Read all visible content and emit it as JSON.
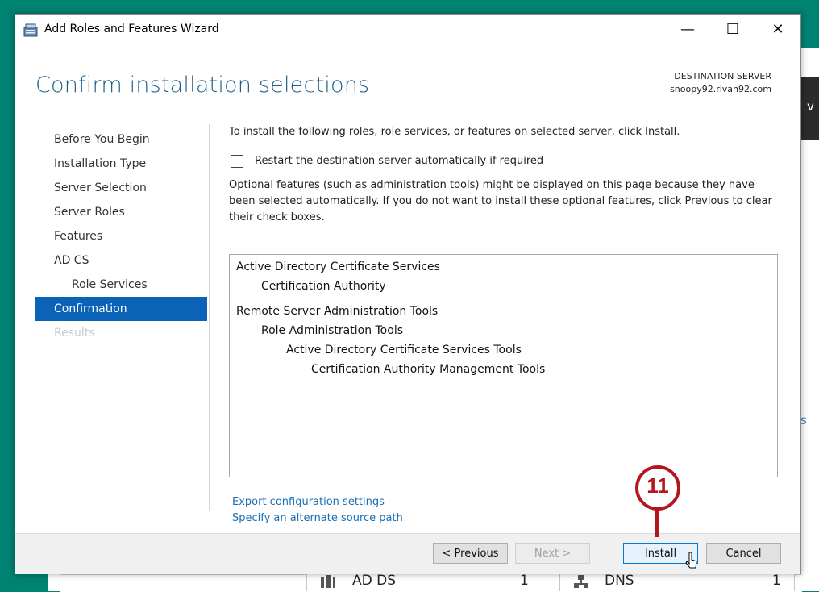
{
  "background": {
    "tiles": [
      {
        "label": "AD DS",
        "count": "1"
      },
      {
        "label": "DNS",
        "count": "1"
      }
    ]
  },
  "window": {
    "title": "Add Roles and Features Wizard",
    "minimize_glyph": "—",
    "maximize_glyph": "☐",
    "close_glyph": "✕"
  },
  "page": {
    "heading": "Confirm installation selections",
    "destination_label": "DESTINATION SERVER",
    "destination_server": "snoopy92.rivan92.com"
  },
  "nav": {
    "items": [
      {
        "label": "Before You Begin",
        "state": "normal"
      },
      {
        "label": "Installation Type",
        "state": "normal"
      },
      {
        "label": "Server Selection",
        "state": "normal"
      },
      {
        "label": "Server Roles",
        "state": "normal"
      },
      {
        "label": "Features",
        "state": "normal"
      },
      {
        "label": "AD CS",
        "state": "normal"
      },
      {
        "label": "Role Services",
        "state": "sub"
      },
      {
        "label": "Confirmation",
        "state": "active"
      },
      {
        "label": "Results",
        "state": "disabled"
      }
    ]
  },
  "content": {
    "instruction": "To install the following roles, role services, or features on selected server, click Install.",
    "restart_checkbox_label": "Restart the destination server automatically if required",
    "restart_checked": false,
    "optional_note": "Optional features (such as administration tools) might be displayed on this page because they have been selected automatically. If you do not want to install these optional features, click Previous to clear their check boxes.",
    "selections": [
      "Active Directory Certificate Services",
      "Certification Authority",
      "Remote Server Administration Tools",
      "Role Administration Tools",
      "Active Directory Certificate Services Tools",
      "Certification Authority Management Tools"
    ],
    "links": {
      "export": "Export configuration settings",
      "alternate_source": "Specify an alternate source path"
    }
  },
  "buttons": {
    "previous": "< Previous",
    "next": "Next >",
    "install": "Install",
    "cancel": "Cancel"
  },
  "callout": {
    "number": "11",
    "color": "#b3161c"
  }
}
